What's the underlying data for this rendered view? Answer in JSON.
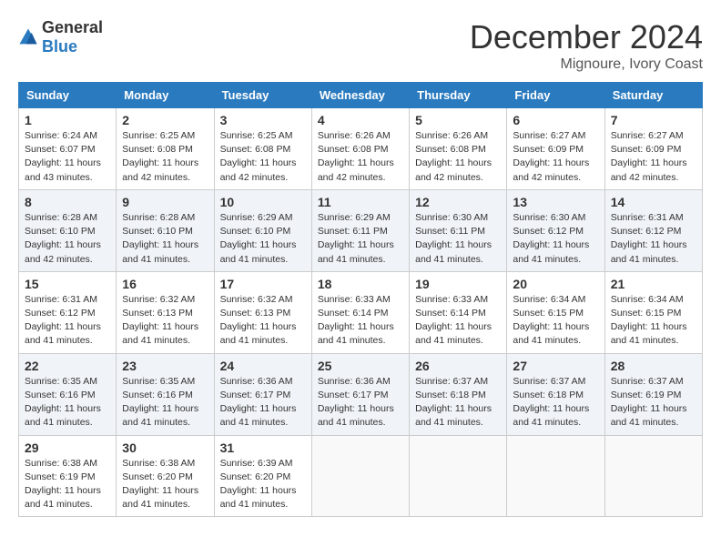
{
  "logo": {
    "general": "General",
    "blue": "Blue"
  },
  "title": {
    "month": "December 2024",
    "location": "Mignoure, Ivory Coast"
  },
  "headers": [
    "Sunday",
    "Monday",
    "Tuesday",
    "Wednesday",
    "Thursday",
    "Friday",
    "Saturday"
  ],
  "weeks": [
    [
      {
        "day": "1",
        "sunrise": "6:24 AM",
        "sunset": "6:07 PM",
        "daylight": "11 hours and 43 minutes."
      },
      {
        "day": "2",
        "sunrise": "6:25 AM",
        "sunset": "6:08 PM",
        "daylight": "11 hours and 42 minutes."
      },
      {
        "day": "3",
        "sunrise": "6:25 AM",
        "sunset": "6:08 PM",
        "daylight": "11 hours and 42 minutes."
      },
      {
        "day": "4",
        "sunrise": "6:26 AM",
        "sunset": "6:08 PM",
        "daylight": "11 hours and 42 minutes."
      },
      {
        "day": "5",
        "sunrise": "6:26 AM",
        "sunset": "6:08 PM",
        "daylight": "11 hours and 42 minutes."
      },
      {
        "day": "6",
        "sunrise": "6:27 AM",
        "sunset": "6:09 PM",
        "daylight": "11 hours and 42 minutes."
      },
      {
        "day": "7",
        "sunrise": "6:27 AM",
        "sunset": "6:09 PM",
        "daylight": "11 hours and 42 minutes."
      }
    ],
    [
      {
        "day": "8",
        "sunrise": "6:28 AM",
        "sunset": "6:10 PM",
        "daylight": "11 hours and 42 minutes."
      },
      {
        "day": "9",
        "sunrise": "6:28 AM",
        "sunset": "6:10 PM",
        "daylight": "11 hours and 41 minutes."
      },
      {
        "day": "10",
        "sunrise": "6:29 AM",
        "sunset": "6:10 PM",
        "daylight": "11 hours and 41 minutes."
      },
      {
        "day": "11",
        "sunrise": "6:29 AM",
        "sunset": "6:11 PM",
        "daylight": "11 hours and 41 minutes."
      },
      {
        "day": "12",
        "sunrise": "6:30 AM",
        "sunset": "6:11 PM",
        "daylight": "11 hours and 41 minutes."
      },
      {
        "day": "13",
        "sunrise": "6:30 AM",
        "sunset": "6:12 PM",
        "daylight": "11 hours and 41 minutes."
      },
      {
        "day": "14",
        "sunrise": "6:31 AM",
        "sunset": "6:12 PM",
        "daylight": "11 hours and 41 minutes."
      }
    ],
    [
      {
        "day": "15",
        "sunrise": "6:31 AM",
        "sunset": "6:12 PM",
        "daylight": "11 hours and 41 minutes."
      },
      {
        "day": "16",
        "sunrise": "6:32 AM",
        "sunset": "6:13 PM",
        "daylight": "11 hours and 41 minutes."
      },
      {
        "day": "17",
        "sunrise": "6:32 AM",
        "sunset": "6:13 PM",
        "daylight": "11 hours and 41 minutes."
      },
      {
        "day": "18",
        "sunrise": "6:33 AM",
        "sunset": "6:14 PM",
        "daylight": "11 hours and 41 minutes."
      },
      {
        "day": "19",
        "sunrise": "6:33 AM",
        "sunset": "6:14 PM",
        "daylight": "11 hours and 41 minutes."
      },
      {
        "day": "20",
        "sunrise": "6:34 AM",
        "sunset": "6:15 PM",
        "daylight": "11 hours and 41 minutes."
      },
      {
        "day": "21",
        "sunrise": "6:34 AM",
        "sunset": "6:15 PM",
        "daylight": "11 hours and 41 minutes."
      }
    ],
    [
      {
        "day": "22",
        "sunrise": "6:35 AM",
        "sunset": "6:16 PM",
        "daylight": "11 hours and 41 minutes."
      },
      {
        "day": "23",
        "sunrise": "6:35 AM",
        "sunset": "6:16 PM",
        "daylight": "11 hours and 41 minutes."
      },
      {
        "day": "24",
        "sunrise": "6:36 AM",
        "sunset": "6:17 PM",
        "daylight": "11 hours and 41 minutes."
      },
      {
        "day": "25",
        "sunrise": "6:36 AM",
        "sunset": "6:17 PM",
        "daylight": "11 hours and 41 minutes."
      },
      {
        "day": "26",
        "sunrise": "6:37 AM",
        "sunset": "6:18 PM",
        "daylight": "11 hours and 41 minutes."
      },
      {
        "day": "27",
        "sunrise": "6:37 AM",
        "sunset": "6:18 PM",
        "daylight": "11 hours and 41 minutes."
      },
      {
        "day": "28",
        "sunrise": "6:37 AM",
        "sunset": "6:19 PM",
        "daylight": "11 hours and 41 minutes."
      }
    ],
    [
      {
        "day": "29",
        "sunrise": "6:38 AM",
        "sunset": "6:19 PM",
        "daylight": "11 hours and 41 minutes."
      },
      {
        "day": "30",
        "sunrise": "6:38 AM",
        "sunset": "6:20 PM",
        "daylight": "11 hours and 41 minutes."
      },
      {
        "day": "31",
        "sunrise": "6:39 AM",
        "sunset": "6:20 PM",
        "daylight": "11 hours and 41 minutes."
      },
      null,
      null,
      null,
      null
    ]
  ]
}
